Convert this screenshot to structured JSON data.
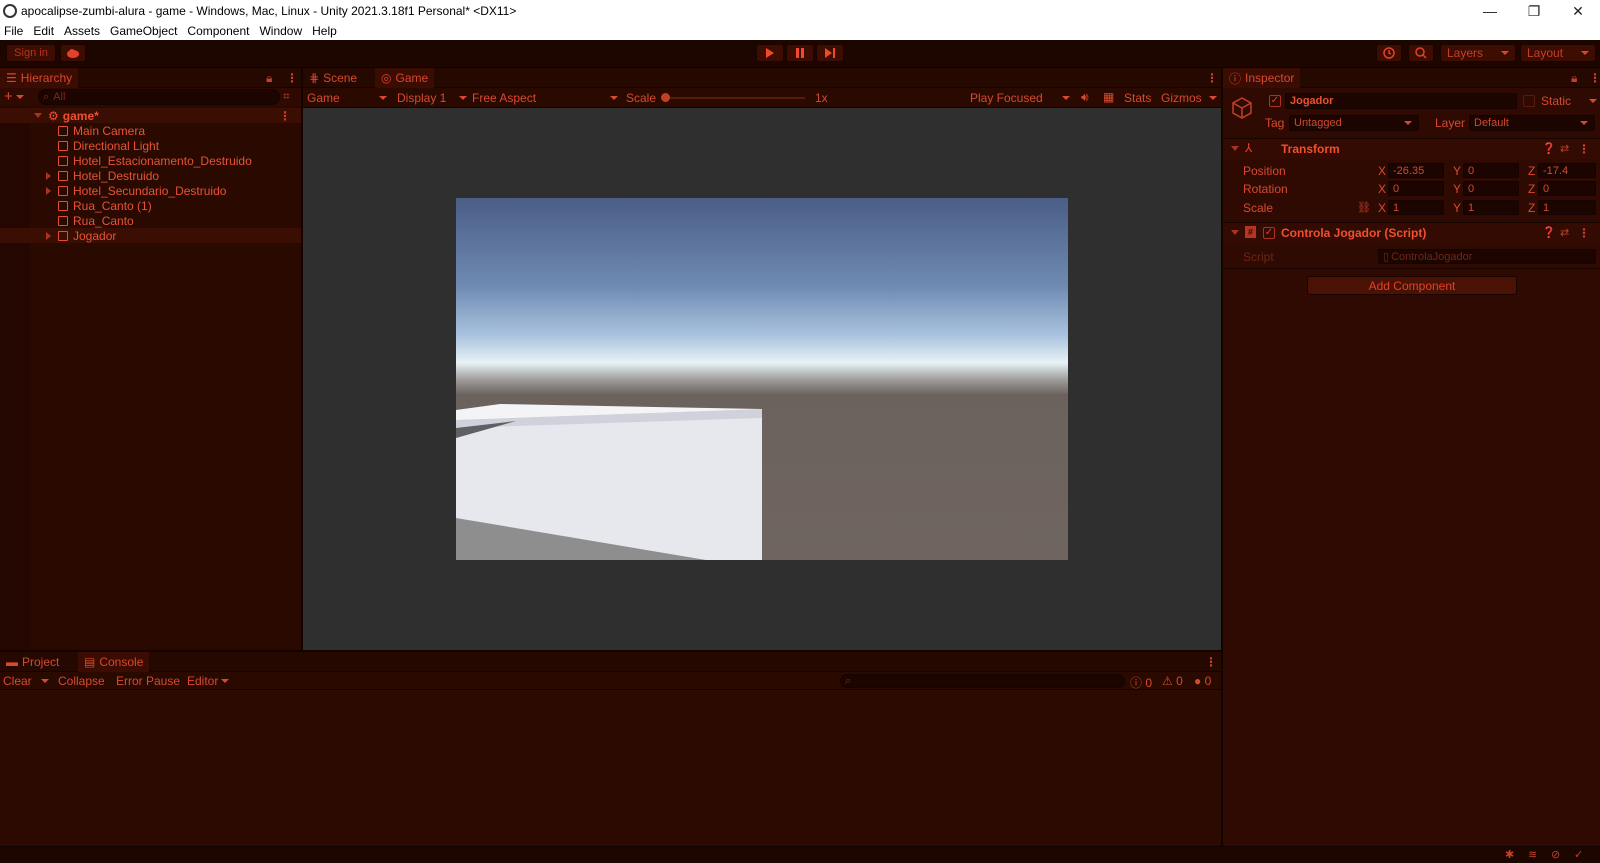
{
  "window": {
    "title": "apocalipse-zumbi-alura - game - Windows, Mac, Linux - Unity 2021.3.18f1 Personal* <DX11>",
    "controls": [
      "—",
      "❐",
      "✕"
    ]
  },
  "menu": [
    "File",
    "Edit",
    "Assets",
    "GameObject",
    "Component",
    "Window",
    "Help"
  ],
  "toolbar": {
    "signin": "Sign in",
    "layers": "Layers",
    "layout": "Layout",
    "icons": [
      "cloud-icon",
      "play-icon",
      "pause-icon",
      "step-icon",
      "history-icon",
      "search-icon"
    ]
  },
  "hierarchy": {
    "tab": "Hierarchy",
    "search_placeholder": "All",
    "scene": "game*",
    "items": [
      {
        "label": "Main Camera",
        "expandable": false
      },
      {
        "label": "Directional Light",
        "expandable": false
      },
      {
        "label": "Hotel_Estacionamento_Destruido",
        "expandable": false
      },
      {
        "label": "Hotel_Destruido",
        "expandable": true
      },
      {
        "label": "Hotel_Secundario_Destruido",
        "expandable": true
      },
      {
        "label": "Rua_Canto (1)",
        "expandable": false
      },
      {
        "label": "Rua_Canto",
        "expandable": false
      },
      {
        "label": "Jogador",
        "expandable": true
      }
    ]
  },
  "gameview": {
    "tabs": [
      "Scene",
      "Game"
    ],
    "display_mode": "Game",
    "display": "Display 1",
    "aspect": "Free Aspect",
    "scale_label": "Scale",
    "scale_value": "1x",
    "play_focused": "Play Focused",
    "stats": "Stats",
    "gizmos": "Gizmos"
  },
  "console": {
    "tabs": [
      "Project",
      "Console"
    ],
    "clear": "Clear",
    "collapse": "Collapse",
    "error_pause": "Error Pause",
    "editor": "Editor",
    "counts": {
      "log": "0",
      "warn": "0",
      "error": "0"
    }
  },
  "inspector": {
    "tab": "Inspector",
    "object_name": "Jogador",
    "static": "Static",
    "tag_label": "Tag",
    "tag_value": "Untagged",
    "layer_label": "Layer",
    "layer_value": "Default",
    "transform": {
      "title": "Transform",
      "position_label": "Position",
      "rotation_label": "Rotation",
      "scale_label": "Scale",
      "position": {
        "x": "-26.35",
        "y": "0",
        "z": "-17.4"
      },
      "rotation": {
        "x": "0",
        "y": "0",
        "z": "0"
      },
      "scale": {
        "x": "1",
        "y": "1",
        "z": "1"
      },
      "axes": {
        "x": "X",
        "y": "Y",
        "z": "Z"
      }
    },
    "script_component": {
      "title": "Controla Jogador (Script)",
      "script_label": "Script",
      "script_value": "ControlaJogador"
    },
    "add_component": "Add Component"
  },
  "colors": {
    "accent": "#e0422a",
    "panel_bg": "#2e0a02",
    "toolbar_bg": "#1d0600"
  }
}
